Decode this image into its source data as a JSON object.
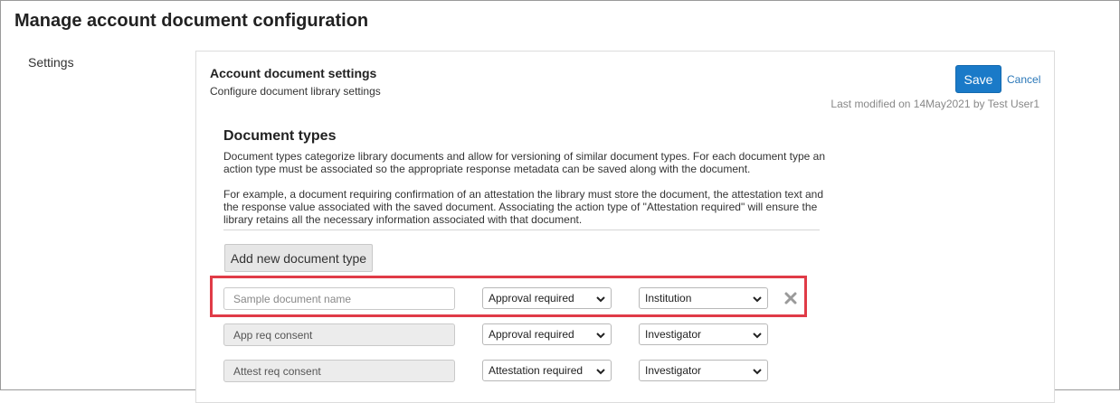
{
  "page": {
    "title": "Manage account document configuration"
  },
  "sidebar": {
    "items": [
      {
        "label": "Settings"
      }
    ]
  },
  "panel": {
    "title": "Account document settings",
    "subtitle": "Configure document library settings",
    "save_label": "Save",
    "cancel_label": "Cancel",
    "last_modified": "Last modified on 14May2021 by Test User1"
  },
  "document_types": {
    "heading": "Document types",
    "description_1": "Document types categorize library documents and allow for versioning of similar document types. For each document type an action type must be associated so the appropriate response metadata can be saved along with the document.",
    "description_2": "For example, a document requiring confirmation of an attestation the library must store the document, the attestation text and the response value associated with the saved document. Associating the action type of \"Attestation required\" will ensure the library retains all the necessary information associated with that document.",
    "add_label": "Add new document type",
    "rows": [
      {
        "name": "",
        "placeholder": "Sample document name",
        "action": "Approval required",
        "role": "Institution",
        "editable": true
      },
      {
        "name": "App req consent",
        "placeholder": "",
        "action": "Approval required",
        "role": "Investigator",
        "editable": false
      },
      {
        "name": "Attest req consent",
        "placeholder": "",
        "action": "Attestation required",
        "role": "Investigator",
        "editable": false
      }
    ]
  },
  "colors": {
    "primary": "#1a7ac8",
    "highlight": "#e03b47",
    "link": "#2a77b8"
  },
  "icons": {
    "remove": "close-icon",
    "dropdown": "chevron-down-icon"
  }
}
